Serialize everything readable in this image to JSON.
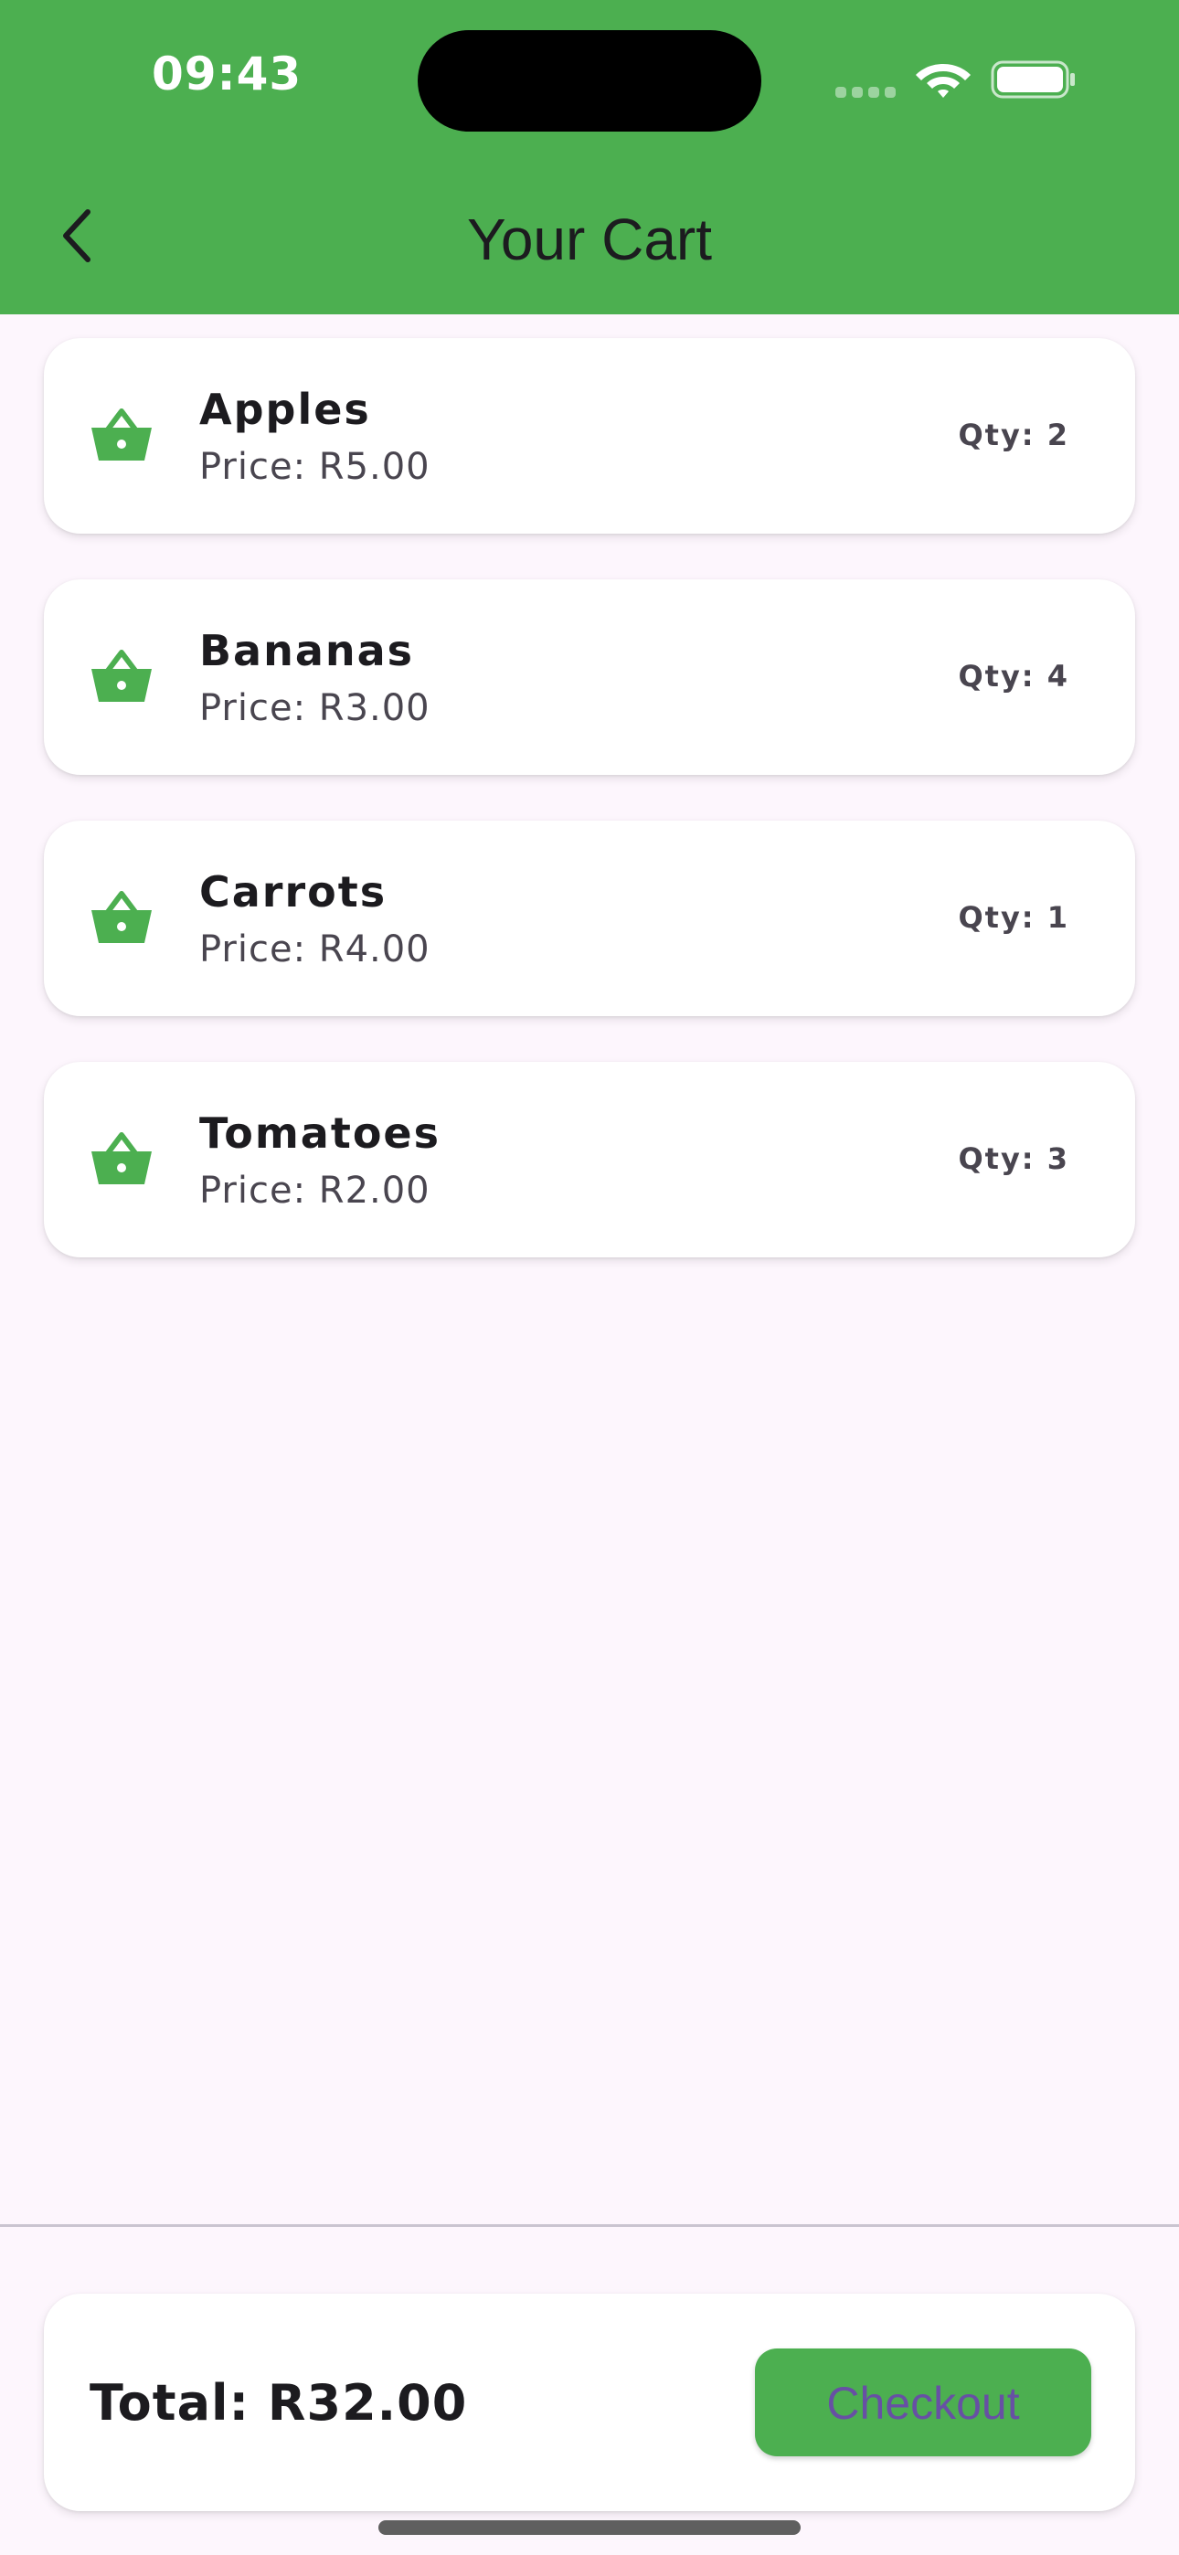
{
  "status_bar": {
    "time": "09:43"
  },
  "header": {
    "title": "Your Cart",
    "back_icon": "chevron-left-icon"
  },
  "colors": {
    "primary": "#4caf50",
    "background": "#fdf6fd",
    "button_text": "#6750a4"
  },
  "cart": {
    "items": [
      {
        "name": "Apples",
        "price": "Price: R5.00",
        "qty": "Qty: 2",
        "icon": "basket-icon"
      },
      {
        "name": "Bananas",
        "price": "Price: R3.00",
        "qty": "Qty: 4",
        "icon": "basket-icon"
      },
      {
        "name": "Carrots",
        "price": "Price: R4.00",
        "qty": "Qty: 1",
        "icon": "basket-icon"
      },
      {
        "name": "Tomatoes",
        "price": "Price: R2.00",
        "qty": "Qty: 3",
        "icon": "basket-icon"
      }
    ]
  },
  "summary": {
    "total": "Total: R32.00",
    "checkout_label": "Checkout"
  }
}
